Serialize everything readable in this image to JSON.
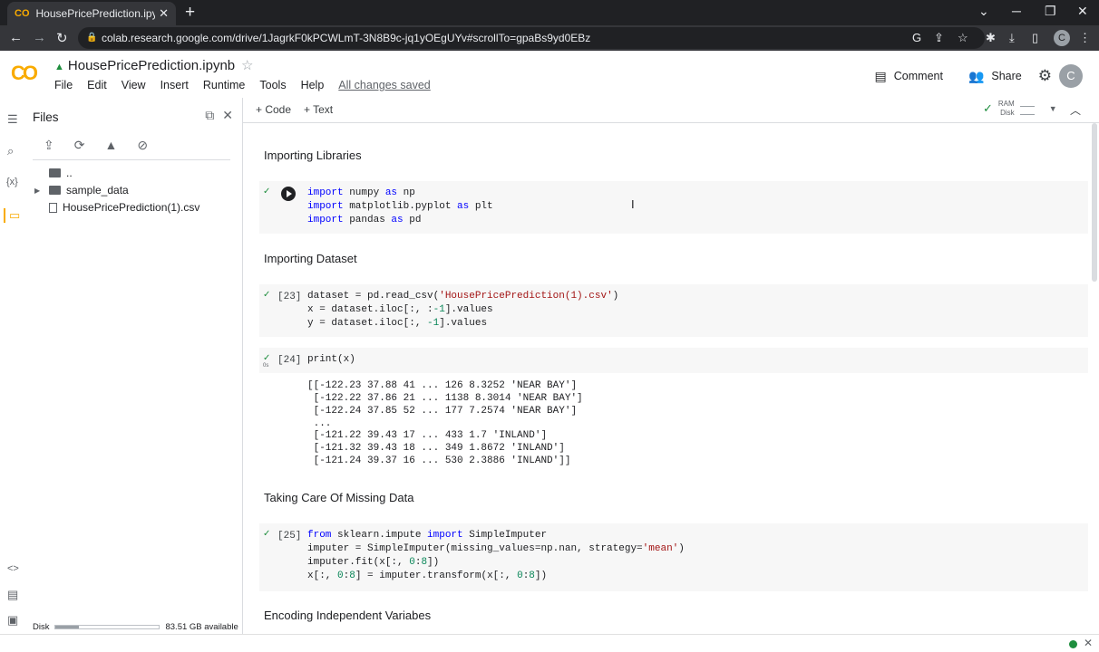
{
  "browser": {
    "tab_title": "HousePricePrediction.ipynb - Col",
    "tab_favicon": "CO",
    "url": "colab.research.google.com/drive/1JagrkF0kPCWLmT-3N8B9c-jq1yOEgUYv#scrollTo=gpaBs9yd0EBz",
    "profile_initial": "C"
  },
  "header": {
    "logo": "CO",
    "title": "HousePricePrediction.ipynb",
    "menu": [
      "File",
      "Edit",
      "View",
      "Insert",
      "Runtime",
      "Tools",
      "Help"
    ],
    "saved_status": "All changes saved",
    "comment_label": "Comment",
    "share_label": "Share",
    "avatar_initial": "C"
  },
  "files_panel": {
    "title": "Files",
    "tree": [
      {
        "label": "..",
        "type": "parent"
      },
      {
        "label": "sample_data",
        "type": "folder"
      },
      {
        "label": "HousePricePrediction(1).csv",
        "type": "file"
      }
    ],
    "disk_label": "Disk",
    "disk_available": "83.51 GB available",
    "disk_used_fraction": 0.22
  },
  "toolbar": {
    "add_code": "+ Code",
    "add_text": "+ Text",
    "ram_label": "RAM",
    "disk_label": "Disk"
  },
  "notebook": {
    "headings": {
      "h1": "Importing Libraries",
      "h2": "Importing Dataset",
      "h3": "Taking Care Of Missing Data",
      "h4": "Encoding Independent Variabes"
    },
    "cell1": {
      "lines": [
        "import numpy as np",
        "import matplotlib.pyplot as plt",
        "import pandas as pd"
      ]
    },
    "cell2": {
      "count": "[23]",
      "lines": [
        "dataset = pd.read_csv('HousePricePrediction(1).csv')",
        "x = dataset.iloc[:, :-1].values",
        "y = dataset.iloc[:, -1].values"
      ]
    },
    "cell3": {
      "count": "[24]",
      "exec_time": "0s",
      "lines": [
        "print(x)"
      ],
      "output": [
        "[[-122.23 37.88 41 ... 126 8.3252 'NEAR BAY']",
        " [-122.22 37.86 21 ... 1138 8.3014 'NEAR BAY']",
        " [-122.24 37.85 52 ... 177 7.2574 'NEAR BAY']",
        " ...",
        " [-121.22 39.43 17 ... 433 1.7 'INLAND']",
        " [-121.32 39.43 18 ... 349 1.8672 'INLAND']",
        " [-121.24 39.37 16 ... 530 2.3886 'INLAND']]"
      ]
    },
    "cell4": {
      "count": "[25]",
      "lines": [
        "from sklearn.impute import SimpleImputer",
        "imputer = SimpleImputer(missing_values=np.nan, strategy='mean')",
        "imputer.fit(x[:, 0:8])",
        "x[:, 0:8] = imputer.transform(x[:, 0:8])"
      ]
    }
  },
  "colors": {
    "accent": "#f9ab00",
    "ok": "#1e8e3e",
    "keyword": "#0000ff",
    "string": "#a31515",
    "number": "#098658"
  }
}
